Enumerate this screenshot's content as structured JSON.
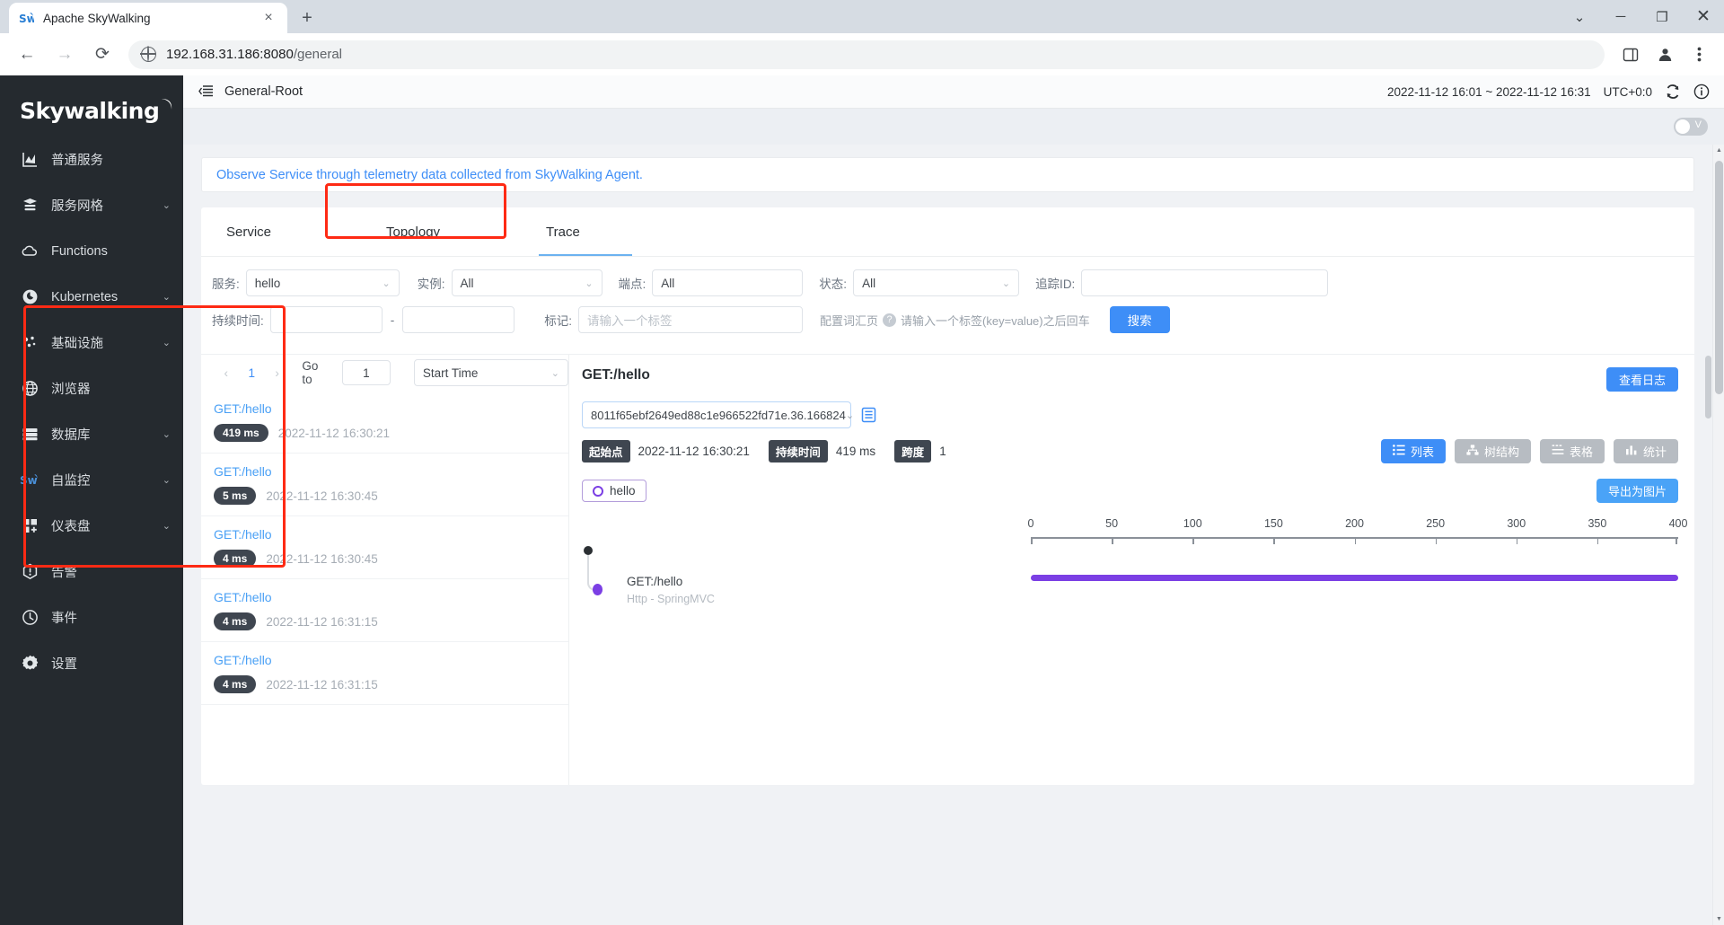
{
  "browser": {
    "tab_title": "Apache SkyWalking",
    "favicon": "skywalking-icon",
    "close_tab": "×",
    "new_tab": "+",
    "url_display": "192.168.31.186:8080",
    "url_path": "/general",
    "back": "←",
    "forward": "→",
    "reload": "⟳",
    "win_minimize": "─",
    "win_maximize": "❐",
    "win_close": "✕",
    "win_chevron": "⌄"
  },
  "sidebar": {
    "logo": "Skywalking",
    "items": [
      {
        "label": "普通服务",
        "icon": "chart-icon",
        "chevron": ""
      },
      {
        "label": "服务网格",
        "icon": "mesh-icon",
        "chevron": "⌄"
      },
      {
        "label": "Functions",
        "icon": "cloud-icon",
        "chevron": ""
      },
      {
        "label": "Kubernetes",
        "icon": "kubernetes-icon",
        "chevron": "⌄"
      },
      {
        "label": "基础设施",
        "icon": "infrastructure-icon",
        "chevron": "⌄"
      },
      {
        "label": "浏览器",
        "icon": "globe-icon",
        "chevron": ""
      },
      {
        "label": "数据库",
        "icon": "database-icon",
        "chevron": "⌄"
      },
      {
        "label": "自监控",
        "icon": "skywalking-sw-icon",
        "chevron": "⌄"
      },
      {
        "label": "仪表盘",
        "icon": "dashboard-icon",
        "chevron": "⌄"
      },
      {
        "label": "告警",
        "icon": "alarm-icon",
        "chevron": ""
      },
      {
        "label": "事件",
        "icon": "event-icon",
        "chevron": ""
      },
      {
        "label": "设置",
        "icon": "settings-icon",
        "chevron": ""
      }
    ]
  },
  "topbar": {
    "menu_icon": "list-menu-icon",
    "title": "General-Root",
    "time_range": "2022-11-12 16:01 ~ 2022-11-12 16:31",
    "timezone": "UTC+0:0",
    "refresh_icon": "refresh-icon",
    "info_icon": "info-icon",
    "toggle_label": "V"
  },
  "banner": {
    "text": "Observe Service through telemetry data collected from SkyWalking Agent."
  },
  "tabs": [
    {
      "label": "Service",
      "active": false
    },
    {
      "label": "Topology",
      "active": false
    },
    {
      "label": "Trace",
      "active": true
    }
  ],
  "filters": {
    "service_label": "服务:",
    "service_value": "hello",
    "instance_label": "实例:",
    "instance_value": "All",
    "endpoint_label": "端点:",
    "endpoint_value": "All",
    "status_label": "状态:",
    "status_value": "All",
    "traceid_label": "追踪ID:",
    "traceid_value": "",
    "duration_label": "持续时间:",
    "duration_from": "",
    "duration_dash": "-",
    "duration_to": "",
    "tags_label": "标记:",
    "tags_placeholder": "请输入一个标签",
    "config_link": "配置词汇页",
    "help_icon": "question-icon",
    "tag_hint": "请输入一个标签(key=value)之后回车",
    "search_button": "搜索"
  },
  "pager": {
    "prev": "‹",
    "page": "1",
    "next": "›",
    "goto_label": "Go to",
    "goto_value": "1",
    "sort_value": "Start Time",
    "sort_chevron": "⌄"
  },
  "trace_list": [
    {
      "name": "GET:/hello",
      "duration": "419 ms",
      "time": "2022-11-12 16:30:21"
    },
    {
      "name": "GET:/hello",
      "duration": "5 ms",
      "time": "2022-11-12 16:30:45"
    },
    {
      "name": "GET:/hello",
      "duration": "4 ms",
      "time": "2022-11-12 16:30:45"
    },
    {
      "name": "GET:/hello",
      "duration": "4 ms",
      "time": "2022-11-12 16:31:15"
    },
    {
      "name": "GET:/hello",
      "duration": "4 ms",
      "time": "2022-11-12 16:31:15"
    }
  ],
  "detail": {
    "title": "GET:/hello",
    "view_logs_button": "查看日志",
    "trace_id": "8011f65ebf2649ed88c1e966522fd71e.36.166824",
    "trace_id_chevron": "⌄",
    "copy_icon": "clipboard-icon",
    "start_label": "起始点",
    "start_value": "2022-11-12 16:30:21",
    "duration_label": "持续时间",
    "duration_value": "419 ms",
    "spans_label": "跨度",
    "spans_value": "1",
    "view_buttons": [
      {
        "label": "列表",
        "icon": "list-view-icon",
        "active": true
      },
      {
        "label": "树结构",
        "icon": "tree-view-icon",
        "active": false
      },
      {
        "label": "表格",
        "icon": "table-view-icon",
        "active": false
      },
      {
        "label": "统计",
        "icon": "stats-view-icon",
        "active": false
      }
    ],
    "service_chip": "hello",
    "service_chip_icon": "circle-outline-icon",
    "export_button": "导出为图片"
  },
  "gantt": {
    "axis_ticks": [
      "0",
      "50",
      "100",
      "150",
      "200",
      "250",
      "300",
      "350",
      "400"
    ],
    "spans": [
      {
        "name": "GET:/hello",
        "sub": "Http - SpringMVC",
        "start_ms": 0,
        "duration_ms": 419,
        "color": "#7b3fe4"
      }
    ],
    "axis_max": 419
  },
  "colors": {
    "accent_blue": "#3e8ef7",
    "link_blue": "#4aa0f5",
    "sidebar_bg": "#252a2f",
    "span_purple": "#7b3fe4",
    "annotation_red": "#fe2a14",
    "badge_dark": "#3f4650"
  }
}
